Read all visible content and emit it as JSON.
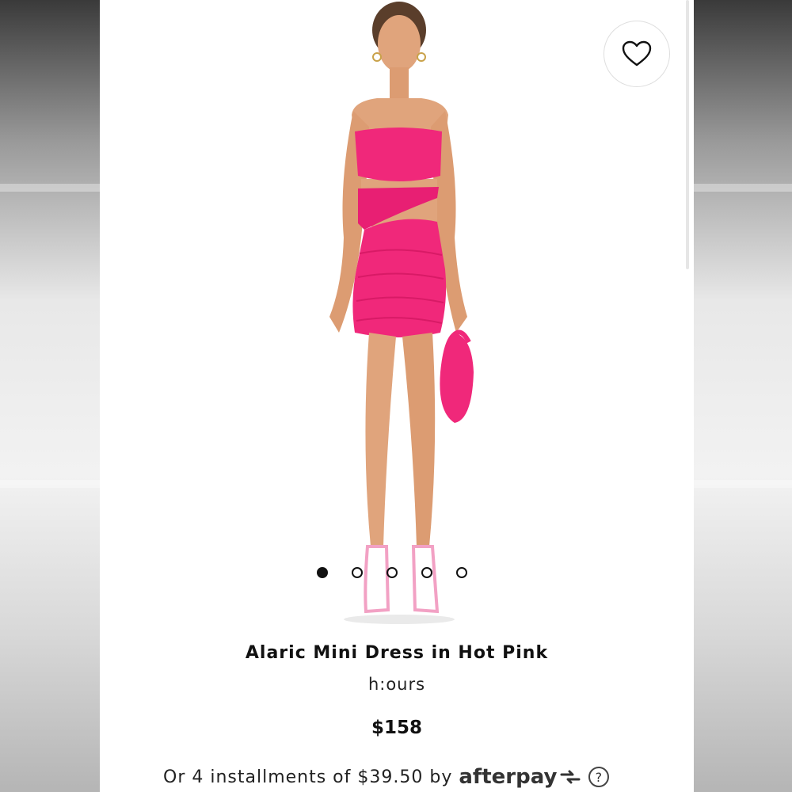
{
  "product": {
    "title": "Alaric Mini Dress in Hot Pink",
    "brand": "h:ours",
    "price": "$158",
    "installments_text": "Or 4 installments of $39.50 by",
    "payment_provider": "afterpay",
    "help_glyph": "?"
  },
  "favorite": {
    "icon": "heart-icon"
  },
  "carousel": {
    "total_images": 5,
    "active_index": 0
  },
  "colors": {
    "dress": "#f0287a",
    "text": "#111111",
    "background": "#ffffff"
  }
}
